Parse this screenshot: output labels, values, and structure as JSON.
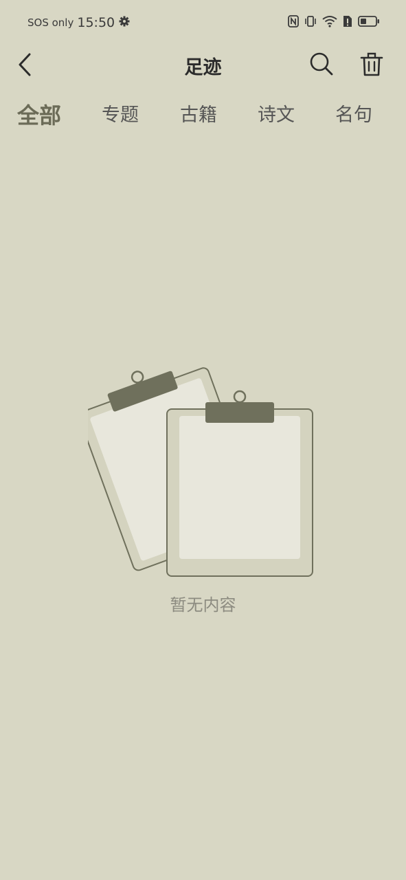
{
  "status_bar": {
    "network": "SOS only",
    "time": "15:50"
  },
  "header": {
    "title": "足迹"
  },
  "tabs": [
    {
      "label": "全部",
      "active": true
    },
    {
      "label": "专题",
      "active": false
    },
    {
      "label": "古籍",
      "active": false
    },
    {
      "label": "诗文",
      "active": false
    },
    {
      "label": "名句",
      "active": false
    }
  ],
  "empty_state": {
    "message": "暂无内容"
  },
  "colors": {
    "background": "#d8d7c4",
    "accent": "#6b6b57",
    "clip": "#6f705c",
    "paper": "#e8e7dc"
  }
}
